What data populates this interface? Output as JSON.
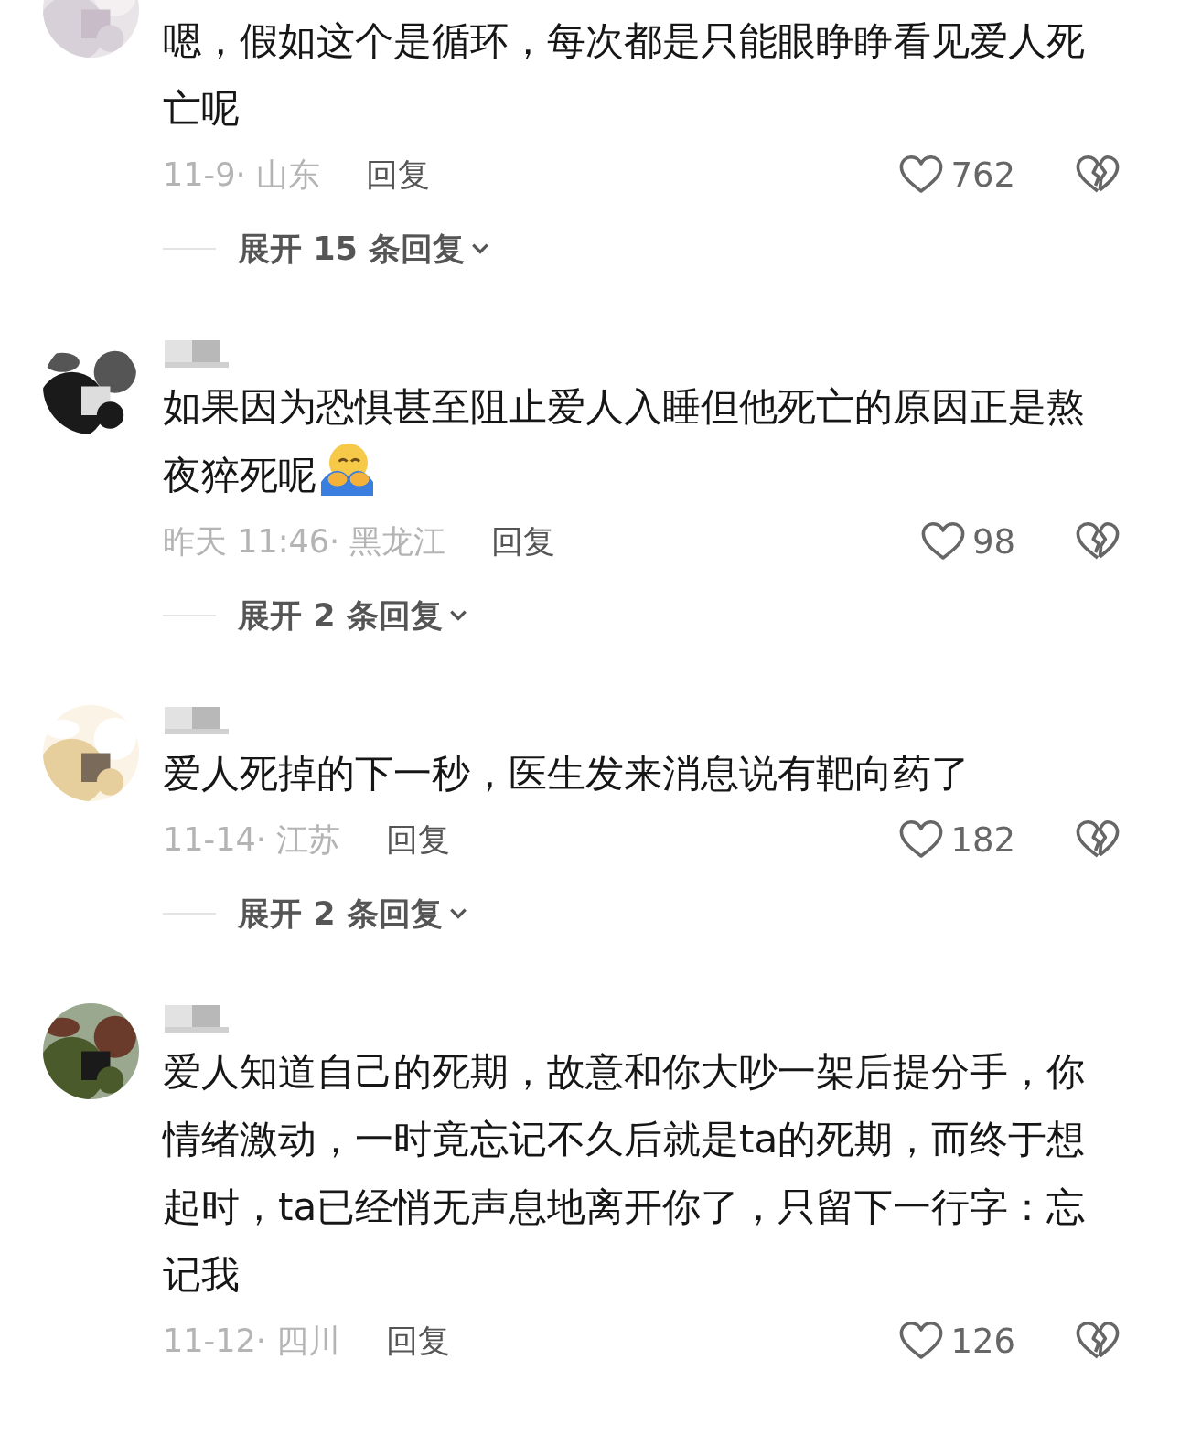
{
  "comments": [
    {
      "text": "嗯，假如这个是循环，每次都是只能眼睁睁看见爱人死亡呢",
      "date": "11-9·",
      "region": "山东",
      "reply": "回复",
      "likes": "762",
      "expand": "展开 15 条回复"
    },
    {
      "name_blurred": true,
      "text": "如果因为恐惧甚至阻止爱人入睡但他死亡的原因正是熬夜猝死呢",
      "emoji": true,
      "date": "昨天 11:46·",
      "region": "黑龙江",
      "reply": "回复",
      "likes": "98",
      "expand": "展开 2 条回复"
    },
    {
      "name_blurred": true,
      "text": "爱人死掉的下一秒，医生发来消息说有靶向药了",
      "date": "11-14·",
      "region": "江苏",
      "reply": "回复",
      "likes": "182",
      "expand": "展开 2 条回复"
    },
    {
      "name_blurred": true,
      "text": "爱人知道自己的死期，故意和你大吵一架后提分手，你情绪激动，一时竟忘记不久后就是ta的死期，而终于想起时，ta已经悄无声息地离开你了，只留下一行字：忘记我",
      "date": "11-12·",
      "region": "四川",
      "reply": "回复",
      "likes": "126"
    }
  ]
}
